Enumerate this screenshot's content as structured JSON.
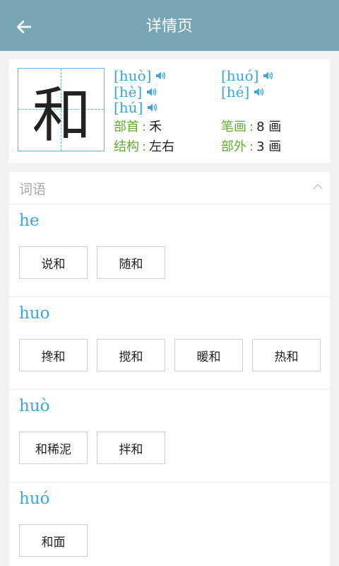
{
  "header": {
    "title": "详情页"
  },
  "character": {
    "glyph": "和",
    "pinyins": [
      "[huò]",
      "[huó]",
      "[hè]",
      "[hé]",
      "[hú]"
    ],
    "attributes": [
      {
        "key": "部首",
        "value": "禾"
      },
      {
        "key": "笔画",
        "value": "8 画"
      },
      {
        "key": "结构",
        "value": "左右"
      },
      {
        "key": "部外",
        "value": "3 画"
      }
    ]
  },
  "words": {
    "title": "词语",
    "groups": [
      {
        "pinyin": "he",
        "items": [
          "说和",
          "随和"
        ]
      },
      {
        "pinyin": "huo",
        "items": [
          "搀和",
          "搅和",
          "暖和",
          "热和"
        ]
      },
      {
        "pinyin": "huò",
        "items": [
          "和稀泥",
          "拌和"
        ]
      },
      {
        "pinyin": "huó",
        "items": [
          "和面"
        ]
      }
    ]
  },
  "colors": {
    "header_bg": "#79a6b5",
    "pinyin": "#3aa7dc",
    "attr_key": "#5fae2e"
  },
  "icons": {
    "back": "arrow-left-icon",
    "speaker": "speaker-icon",
    "collapse": "chevron-up-icon"
  }
}
